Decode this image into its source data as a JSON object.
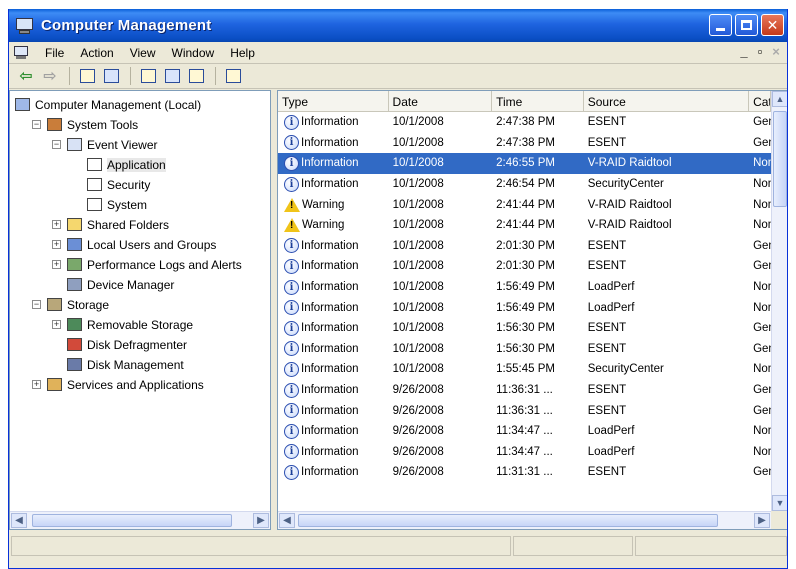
{
  "window": {
    "title": "Computer Management"
  },
  "menu": [
    {
      "label": "File"
    },
    {
      "label": "Action"
    },
    {
      "label": "View"
    },
    {
      "label": "Window"
    },
    {
      "label": "Help"
    }
  ],
  "mdi_controls": {
    "minimize": "_",
    "restore": "\u0000",
    "close": "×"
  },
  "toolbar": {
    "buttons": [
      "back-arrow-icon",
      "forward-arrow-icon",
      "up-folder-icon",
      "show-hide-tree-icon",
      "properties-icon",
      "refresh-icon",
      "export-list-icon",
      "help-icon"
    ]
  },
  "tree": {
    "items": [
      {
        "label": "Computer Management (Local)",
        "level": 0,
        "icon": "computer-icon",
        "expander": ""
      },
      {
        "label": "System Tools",
        "level": 1,
        "icon": "toolbox-icon",
        "expander": "-"
      },
      {
        "label": "Event Viewer",
        "level": 2,
        "icon": "event-viewer-icon",
        "expander": "-"
      },
      {
        "label": "Application",
        "level": 3,
        "icon": "log-icon",
        "expander": "",
        "selected": true
      },
      {
        "label": "Security",
        "level": 3,
        "icon": "log-icon",
        "expander": ""
      },
      {
        "label": "System",
        "level": 3,
        "icon": "log-icon",
        "expander": ""
      },
      {
        "label": "Shared Folders",
        "level": 2,
        "icon": "shared-folder-icon",
        "expander": "+"
      },
      {
        "label": "Local Users and Groups",
        "level": 2,
        "icon": "users-icon",
        "expander": "+"
      },
      {
        "label": "Performance Logs and Alerts",
        "level": 2,
        "icon": "performance-icon",
        "expander": "+"
      },
      {
        "label": "Device Manager",
        "level": 2,
        "icon": "device-manager-icon",
        "expander": ""
      },
      {
        "label": "Storage",
        "level": 1,
        "icon": "storage-icon",
        "expander": "-"
      },
      {
        "label": "Removable Storage",
        "level": 2,
        "icon": "removable-storage-icon",
        "expander": "+"
      },
      {
        "label": "Disk Defragmenter",
        "level": 2,
        "icon": "defrag-icon",
        "expander": ""
      },
      {
        "label": "Disk Management",
        "level": 2,
        "icon": "disk-management-icon",
        "expander": ""
      },
      {
        "label": "Services and Applications",
        "level": 1,
        "icon": "services-icon",
        "expander": "+"
      }
    ]
  },
  "events": {
    "columns": [
      "Type",
      "Date",
      "Time",
      "Source",
      "Cate"
    ],
    "rows": [
      {
        "type": "Information",
        "date": "10/1/2008",
        "time": "2:47:38 PM",
        "source": "ESENT",
        "category": "Gen"
      },
      {
        "type": "Information",
        "date": "10/1/2008",
        "time": "2:47:38 PM",
        "source": "ESENT",
        "category": "Gen"
      },
      {
        "type": "Information",
        "date": "10/1/2008",
        "time": "2:46:55 PM",
        "source": "V-RAID Raidtool",
        "category": "Non",
        "selected": true
      },
      {
        "type": "Information",
        "date": "10/1/2008",
        "time": "2:46:54 PM",
        "source": "SecurityCenter",
        "category": "Non"
      },
      {
        "type": "Warning",
        "date": "10/1/2008",
        "time": "2:41:44 PM",
        "source": "V-RAID Raidtool",
        "category": "Non"
      },
      {
        "type": "Warning",
        "date": "10/1/2008",
        "time": "2:41:44 PM",
        "source": "V-RAID Raidtool",
        "category": "Non"
      },
      {
        "type": "Information",
        "date": "10/1/2008",
        "time": "2:01:30 PM",
        "source": "ESENT",
        "category": "Gen"
      },
      {
        "type": "Information",
        "date": "10/1/2008",
        "time": "2:01:30 PM",
        "source": "ESENT",
        "category": "Gen"
      },
      {
        "type": "Information",
        "date": "10/1/2008",
        "time": "1:56:49 PM",
        "source": "LoadPerf",
        "category": "Non"
      },
      {
        "type": "Information",
        "date": "10/1/2008",
        "time": "1:56:49 PM",
        "source": "LoadPerf",
        "category": "Non"
      },
      {
        "type": "Information",
        "date": "10/1/2008",
        "time": "1:56:30 PM",
        "source": "ESENT",
        "category": "Gen"
      },
      {
        "type": "Information",
        "date": "10/1/2008",
        "time": "1:56:30 PM",
        "source": "ESENT",
        "category": "Gen"
      },
      {
        "type": "Information",
        "date": "10/1/2008",
        "time": "1:55:45 PM",
        "source": "SecurityCenter",
        "category": "Non"
      },
      {
        "type": "Information",
        "date": "9/26/2008",
        "time": "11:36:31 ...",
        "source": "ESENT",
        "category": "Gen"
      },
      {
        "type": "Information",
        "date": "9/26/2008",
        "time": "11:36:31 ...",
        "source": "ESENT",
        "category": "Gen"
      },
      {
        "type": "Information",
        "date": "9/26/2008",
        "time": "11:34:47 ...",
        "source": "LoadPerf",
        "category": "Non"
      },
      {
        "type": "Information",
        "date": "9/26/2008",
        "time": "11:34:47 ...",
        "source": "LoadPerf",
        "category": "Non"
      },
      {
        "type": "Information",
        "date": "9/26/2008",
        "time": "11:31:31 ...",
        "source": "ESENT",
        "category": "Gen"
      }
    ]
  },
  "status": {
    "cells": [
      "",
      "",
      ""
    ]
  },
  "colors": {
    "title_bar": "#0a4ec4",
    "selection": "#316ac5",
    "window_face": "#ece9d8",
    "warning": "#f0c419"
  }
}
